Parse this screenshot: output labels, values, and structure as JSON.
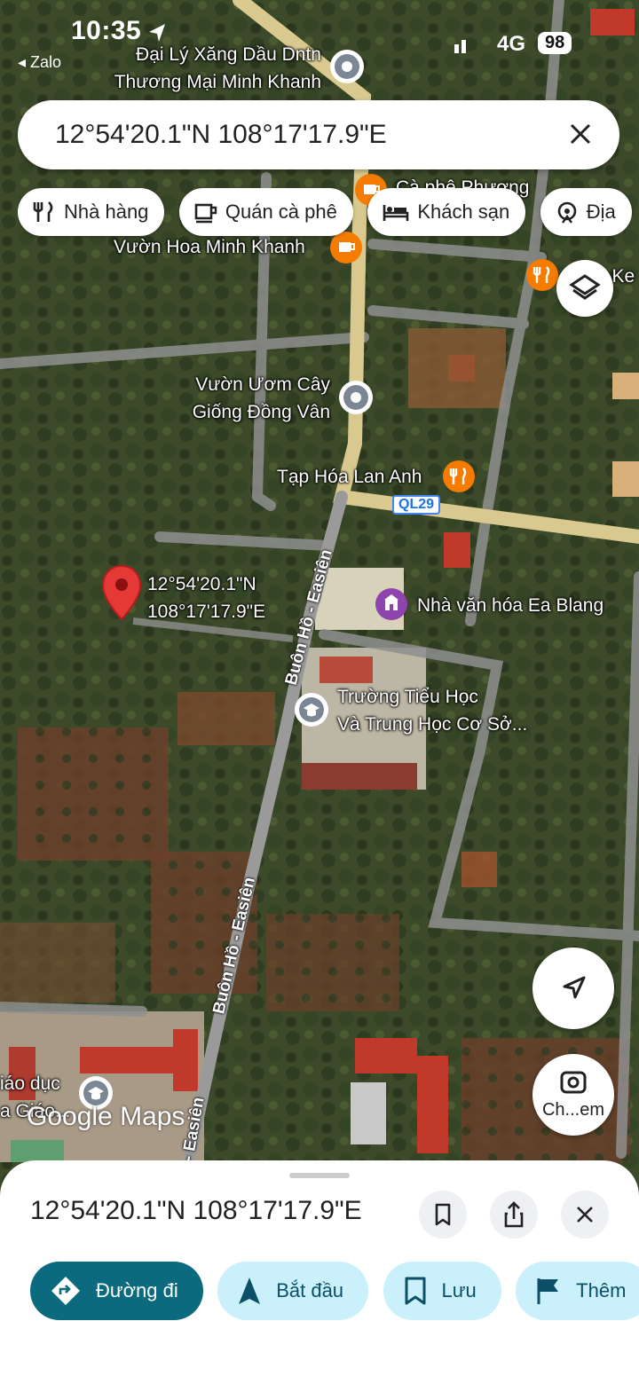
{
  "status_bar": {
    "time": "10:35",
    "back_app": "◂ Zalo",
    "network": "4G",
    "battery": "98"
  },
  "search": {
    "value": "12°54'20.1\"N 108°17'17.9\"E"
  },
  "chips": [
    {
      "label": "Nhà hàng",
      "icon": "restaurant-icon"
    },
    {
      "label": "Quán cà phê",
      "icon": "coffee-icon"
    },
    {
      "label": "Khách sạn",
      "icon": "hotel-icon"
    },
    {
      "label": "Địa",
      "icon": "attraction-icon"
    }
  ],
  "map": {
    "places": {
      "gas_station": [
        "Đại Lý Xăng Dầu Dntn",
        "Thương Mại Minh Khanh"
      ],
      "cafe_top": "Cà phê Phương",
      "garden": "Vườn Hoa Minh Khanh",
      "restaurant_right": "n Ke",
      "nursery": [
        "Vườn Ươm Cây",
        "Giống Đồng Vân"
      ],
      "grocery": "Tạp Hóa Lan Anh",
      "culture_house": "Nhà văn hóa Ea Blang",
      "school": [
        "Trường Tiểu Học",
        "Và Trung Học Cơ Sở..."
      ],
      "edu_bottom": [
        "iáo dục",
        "a Giáo..."
      ]
    },
    "dropped_pin": [
      "12°54'20.1\"N",
      "108°17'17.9\"E"
    ],
    "road_shield": "QL29",
    "road_name_1": "Buôn Hồ - Easiên",
    "road_name_2": "Buôn Hồ - Easiên",
    "road_name_3": "- Easiên",
    "logo": "Google Maps",
    "camera_button": "Ch...em"
  },
  "sheet": {
    "title": "12°54'20.1\"N 108°17'17.9\"E",
    "actions": [
      {
        "label": "Đường đi",
        "icon": "directions-icon"
      },
      {
        "label": "Bắt đầu",
        "icon": "navigation-arrow-icon"
      },
      {
        "label": "Lưu",
        "icon": "bookmark-icon"
      },
      {
        "label": "Thêm",
        "icon": "flag-icon"
      }
    ]
  },
  "colors": {
    "accent_teal": "#0b6a7d",
    "chip_light": "#c9f0fb",
    "pin_red": "#e53935",
    "road_yellow": "#e8d9a0",
    "restaurant_orange": "#f57c00",
    "purple_poi": "#8e44ad"
  }
}
